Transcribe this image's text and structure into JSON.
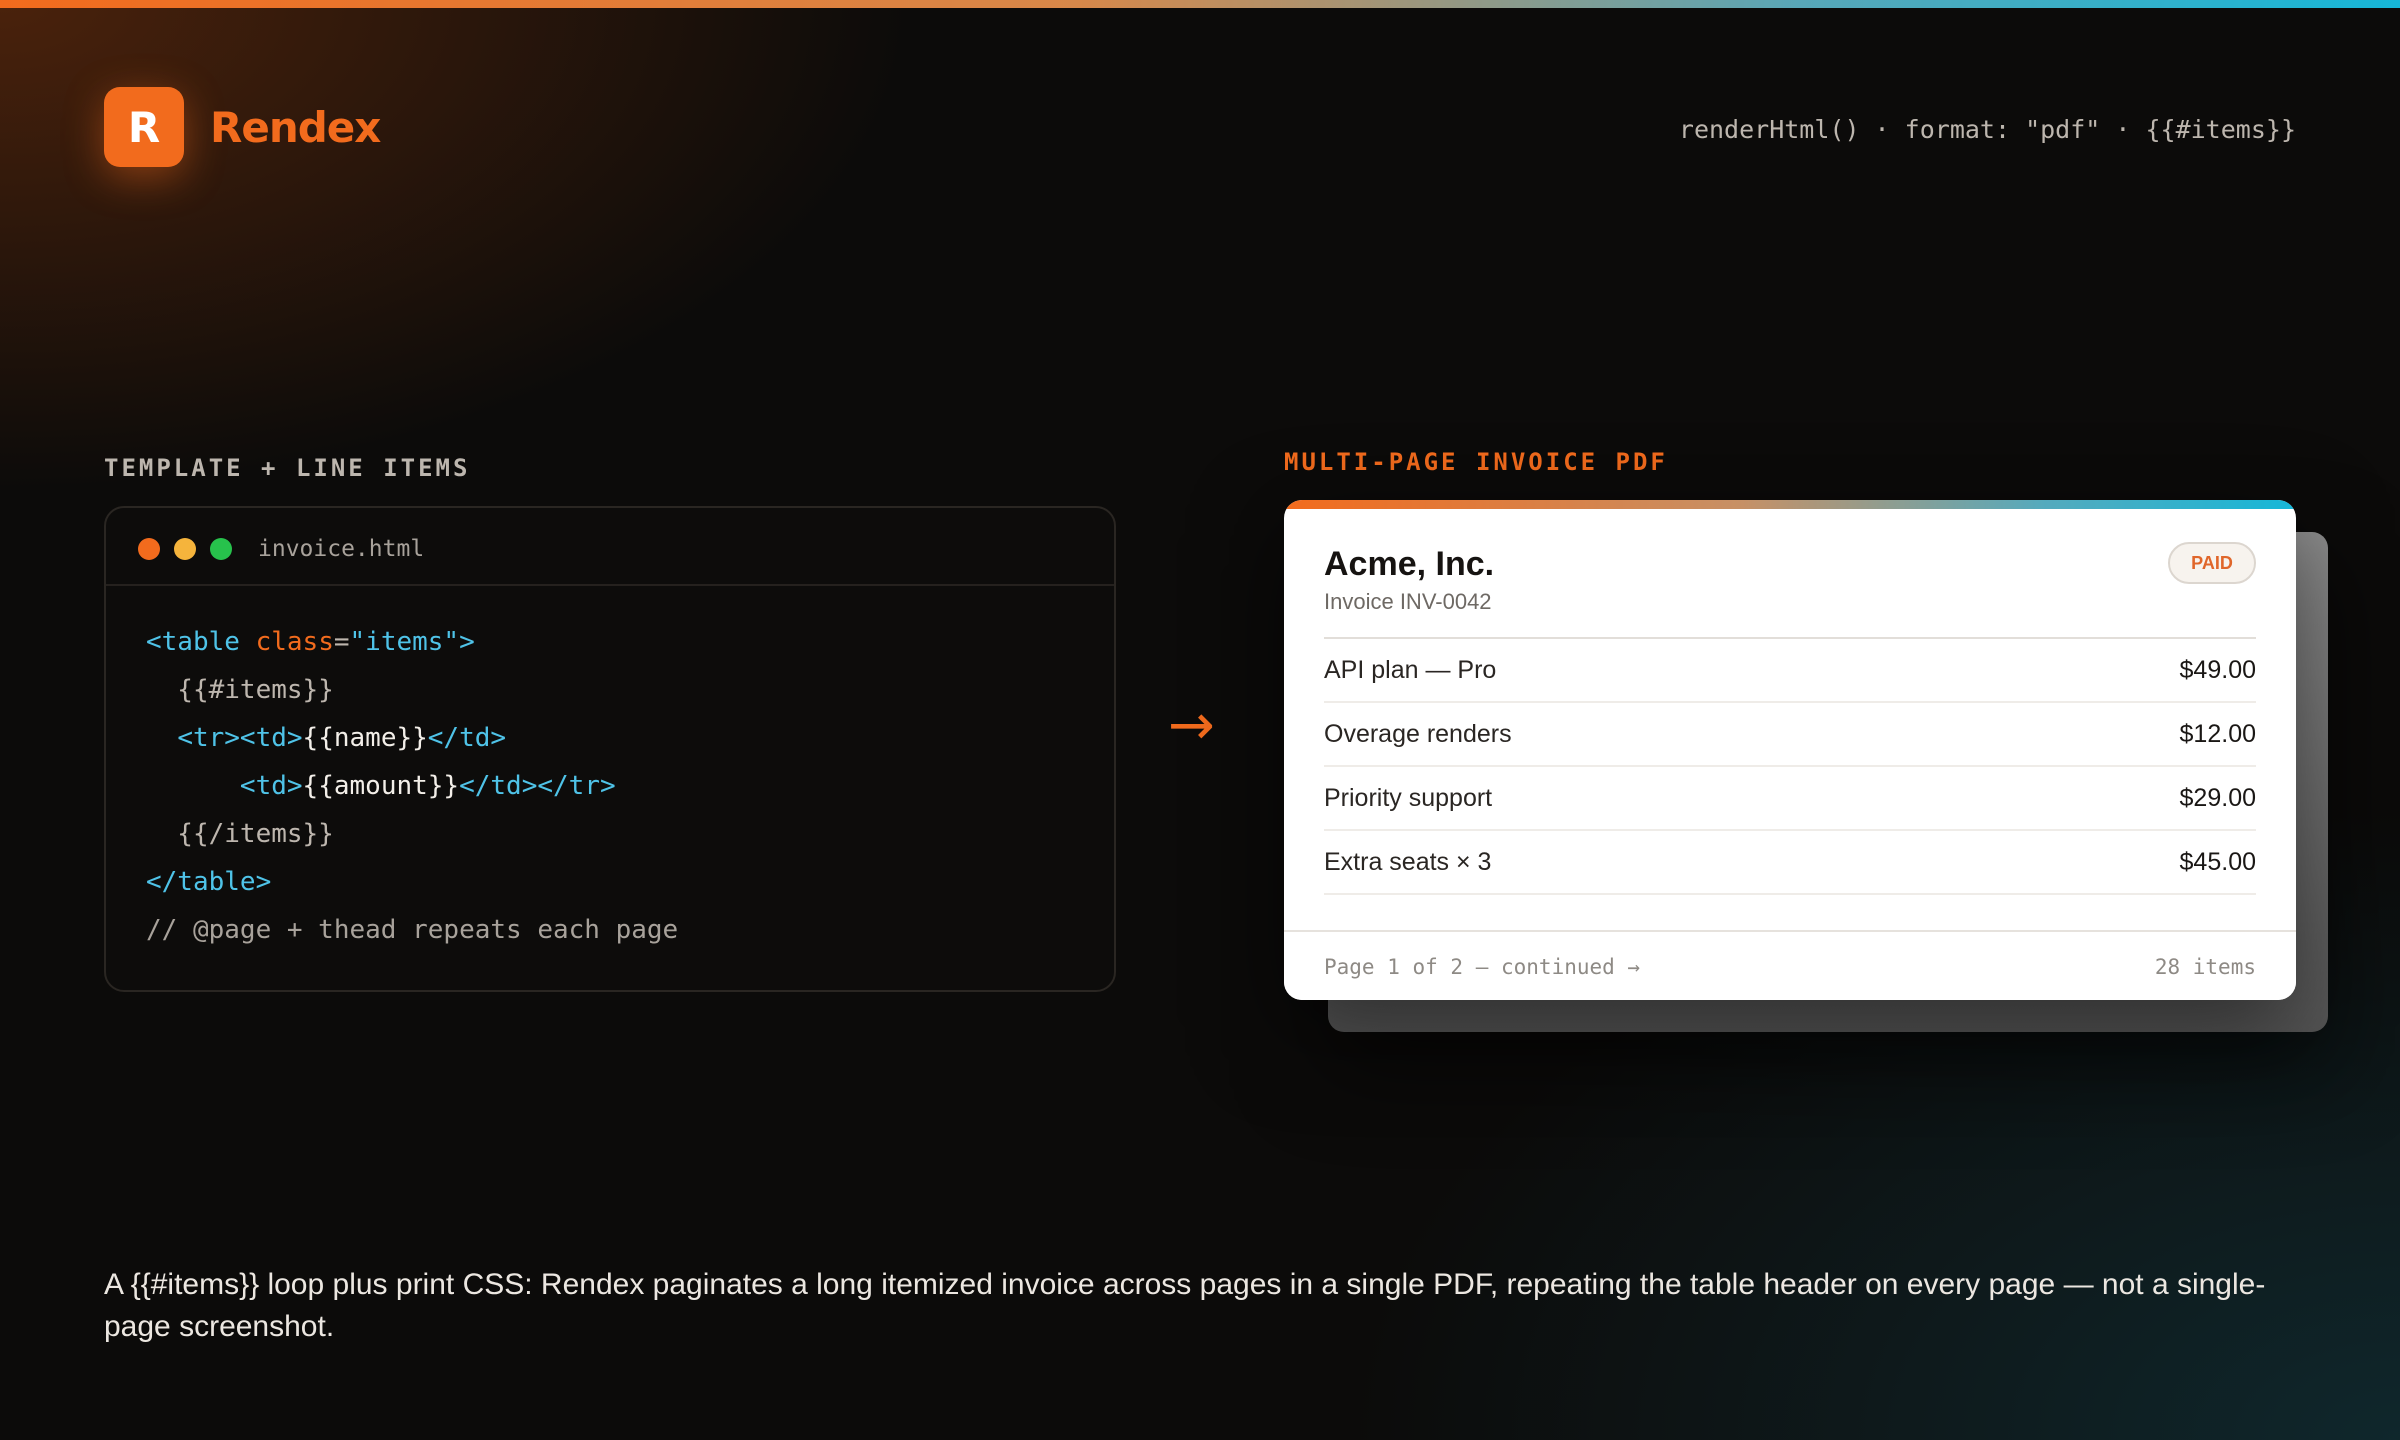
{
  "brand": {
    "logo_letter": "R",
    "name": "Rendex",
    "accent_color": "#f26b1d"
  },
  "header_hint": "renderHtml() · format: \"pdf\" · {{#items}}",
  "template_panel": {
    "label": "TEMPLATE + LINE ITEMS",
    "filename": "invoice.html",
    "window_dots": [
      "#f26b1d",
      "#f5b43c",
      "#27c24c"
    ],
    "code": {
      "l1_open": "<table ",
      "l1_attr": "class",
      "l1_eq": "=",
      "l1_val": "\"items\"",
      "l1_close": ">",
      "l2": "  {{#items}}",
      "l3_indent": "  ",
      "l3_open": "<tr><td>",
      "l3_text": "{{name}}",
      "l3_close": "</td>",
      "l4_indent": "      ",
      "l4_open": "<td>",
      "l4_text": "{{amount}}",
      "l4_close": "</td></tr>",
      "l5": "  {{/items}}",
      "l6": "</table>",
      "l7": "// @page + thead repeats each page"
    }
  },
  "arrow": "→",
  "pdf_panel": {
    "label": "MULTI-PAGE INVOICE PDF",
    "company": "Acme, Inc.",
    "invoice_number": "Invoice INV-0042",
    "status_badge": "PAID",
    "line_items": [
      {
        "name": "API plan — Pro",
        "amount": "$49.00"
      },
      {
        "name": "Overage renders",
        "amount": "$12.00"
      },
      {
        "name": "Priority support",
        "amount": "$29.00"
      },
      {
        "name": "Extra seats × 3",
        "amount": "$45.00"
      }
    ],
    "footer_left": "Page 1 of 2 — continued →",
    "footer_right": "28 items"
  },
  "caption": "A {{#items}} loop plus print CSS: Rendex paginates a long itemized invoice across pages in a single PDF, repeating the table header on every page — not a single-page screenshot."
}
